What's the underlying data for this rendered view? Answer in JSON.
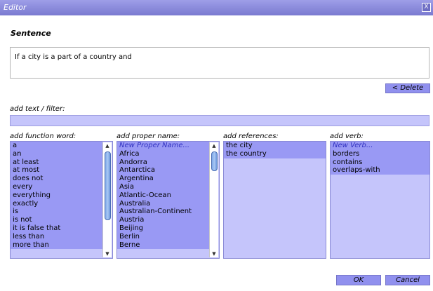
{
  "window": {
    "title": "Editor",
    "close_glyph": "X"
  },
  "sentence": {
    "heading": "Sentence",
    "text": "If a city is a part of a country and",
    "delete_label": "< Delete"
  },
  "filter": {
    "label": "add text / filter:",
    "value": ""
  },
  "columns": {
    "function_word": {
      "label": "add function word:",
      "items": [
        "a",
        "an",
        "at least",
        "at most",
        "does not",
        "every",
        "everything",
        "exactly",
        "is",
        "is not",
        "it is false that",
        "less than",
        "more than"
      ]
    },
    "proper_name": {
      "label": "add proper name:",
      "items": [
        "New Proper Name...",
        "Africa",
        "Andorra",
        "Antarctica",
        "Argentina",
        "Asia",
        "Atlantic-Ocean",
        "Australia",
        "Australian-Continent",
        "Austria",
        "Beijing",
        "Berlin",
        "Berne"
      ]
    },
    "references": {
      "label": "add references:",
      "items": [
        "the city",
        "the country"
      ]
    },
    "verb": {
      "label": "add verb:",
      "items": [
        "New Verb...",
        "borders",
        "contains",
        "overlaps-with"
      ]
    }
  },
  "buttons": {
    "ok_label": "OK",
    "cancel_label": "Cancel"
  },
  "colors": {
    "titlebar": "#8a8ade",
    "list_bg": "#c5c5fb",
    "list_item_bg": "#9999f4",
    "button": "#9090ee"
  }
}
